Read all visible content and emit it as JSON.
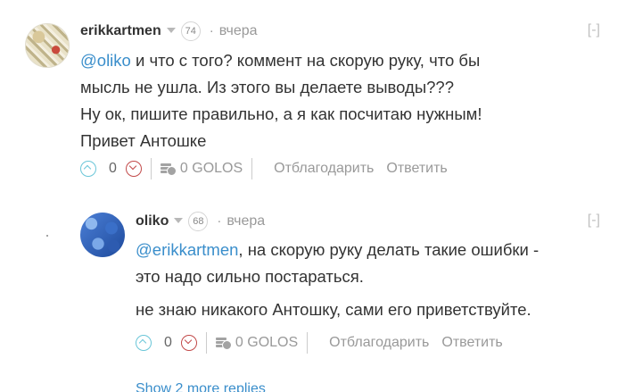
{
  "comments": [
    {
      "author": "erikkartmen",
      "reputation": "74",
      "time": "вчера",
      "collapse": "[-]",
      "mention": "@oliko",
      "lines": [
        " и что с того? коммент на скорую руку, что бы",
        "мысль не ушла. Из этого вы делаете выводы???",
        "Ну ок, пишите правильно, а я как посчитаю нужным!",
        "Привет Антошке"
      ],
      "votes": "0",
      "payout": "0 GOLOS",
      "thanks_label": "Отблагодарить",
      "reply_label": "Ответить"
    },
    {
      "author": "oliko",
      "reputation": "68",
      "time": "вчера",
      "collapse": "[-]",
      "mention": "@erikkartmen",
      "lines": [
        ", на скорую руку делать такие ошибки -",
        "это надо сильно постараться.",
        "не знаю никакого Антошку, сами его приветствуйте."
      ],
      "votes": "0",
      "payout": "0 GOLOS",
      "thanks_label": "Отблагодарить",
      "reply_label": "Ответить"
    }
  ],
  "more_replies": "Show 2 more replies",
  "colors": {
    "link": "#3a8ecb",
    "upvote": "#6ac6d8",
    "downvote": "#c24a4a"
  }
}
